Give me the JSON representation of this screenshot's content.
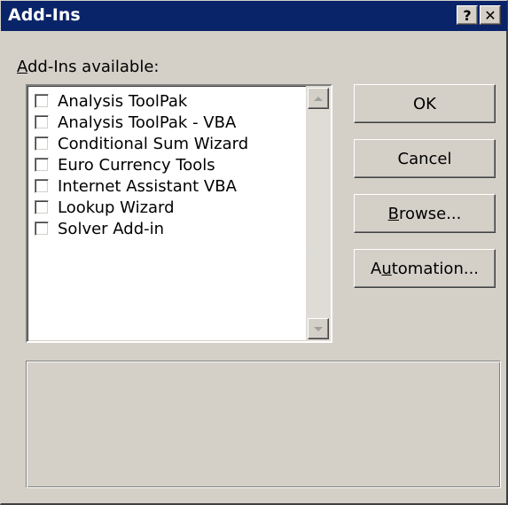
{
  "window": {
    "title": "Add-Ins",
    "help_label": "?",
    "close_label": "✕"
  },
  "addins": {
    "label_mnemonic": "A",
    "label_rest": "dd-Ins available:",
    "items": [
      {
        "label": "Analysis ToolPak",
        "checked": false
      },
      {
        "label": "Analysis ToolPak - VBA",
        "checked": false
      },
      {
        "label": "Conditional Sum Wizard",
        "checked": false
      },
      {
        "label": "Euro Currency Tools",
        "checked": false
      },
      {
        "label": "Internet Assistant VBA",
        "checked": false
      },
      {
        "label": "Lookup Wizard",
        "checked": false
      },
      {
        "label": "Solver Add-in",
        "checked": false
      }
    ]
  },
  "buttons": {
    "ok": "OK",
    "cancel": "Cancel",
    "browse_mnemonic": "B",
    "browse_rest": "rowse...",
    "automation_pre": "A",
    "automation_mnemonic": "u",
    "automation_rest": "tomation..."
  },
  "colors": {
    "titlebar": "#0a246a",
    "face": "#d4d0c8"
  }
}
